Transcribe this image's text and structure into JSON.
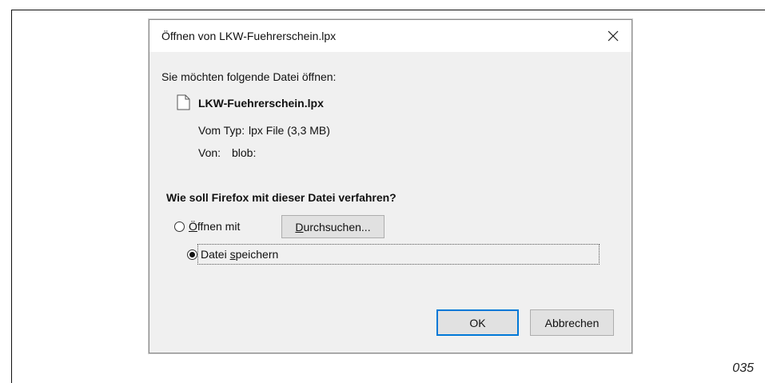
{
  "dialog": {
    "title": "Öffnen von LKW-Fuehrerschein.lpx",
    "close_symbol": "✕",
    "intro": "Sie möchten folgende Datei öffnen:",
    "file_name": "LKW-Fuehrerschein.lpx",
    "type_label": "Vom Typ:",
    "type_value": "lpx File (3,3 MB)",
    "from_label": "Von:",
    "from_value": "blob:",
    "question": "Wie soll Firefox mit dieser Datei verfahren?",
    "open_with": {
      "accesskey": "Ö",
      "rest": "ffnen mit",
      "checked": false
    },
    "browse": {
      "accesskey": "D",
      "rest": "urchsuchen..."
    },
    "save_file": {
      "before": "Datei ",
      "accesskey": "s",
      "rest": "peichern",
      "checked": true
    },
    "ok_label": "OK",
    "cancel_label": "Abbrechen"
  },
  "page_number": "035",
  "icons": {
    "file": "file-icon",
    "close": "close-icon"
  },
  "colors": {
    "dialog_bg": "#f0f0f0",
    "titlebar_bg": "#ffffff",
    "default_button_border": "#0078d7",
    "button_bg": "#e1e1e1"
  }
}
